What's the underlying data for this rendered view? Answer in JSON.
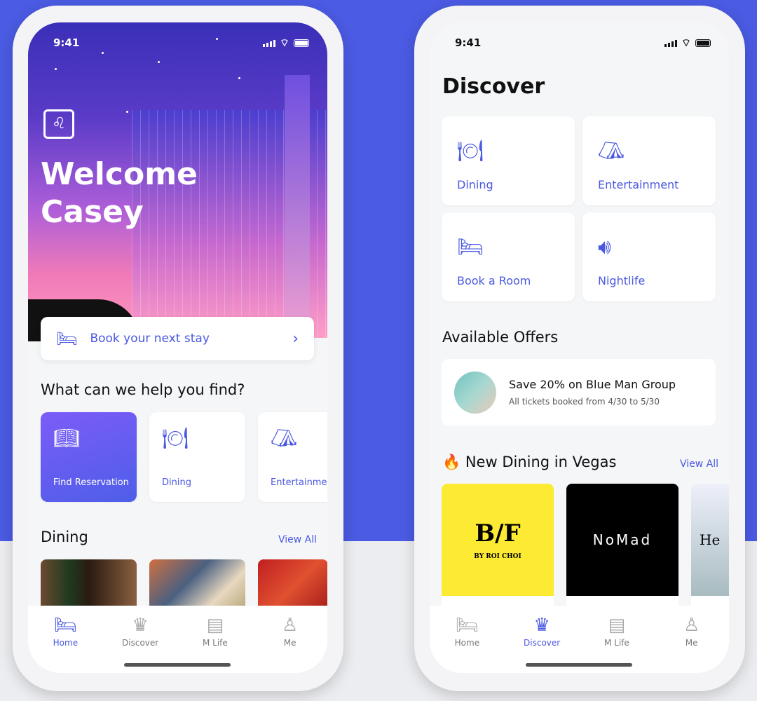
{
  "colors": {
    "accent": "#4a58e0",
    "background": "#4b5be3"
  },
  "home": {
    "status_time": "9:41",
    "welcome": "Welcome Casey",
    "book_stay": "Book your next stay",
    "help_title": "What can we help you find?",
    "quick": [
      {
        "label": "Find Reservation",
        "icon": "book-icon"
      },
      {
        "label": "Dining",
        "icon": "dining-icon"
      },
      {
        "label": "Entertainment",
        "icon": "tent-icon"
      }
    ],
    "dining_title": "Dining",
    "view_all": "View All"
  },
  "discover": {
    "status_time": "9:41",
    "title": "Discover",
    "tiles": [
      {
        "label": "Dining",
        "icon": "dining-icon"
      },
      {
        "label": "Entertainment",
        "icon": "tent-icon"
      },
      {
        "label": "Book a Room",
        "icon": "bed-icon"
      },
      {
        "label": "Nightlife",
        "icon": "speaker-icon"
      }
    ],
    "offers_title": "Available Offers",
    "offer": {
      "title": "Save 20% on Blue Man Group",
      "subtitle": "All tickets booked from 4/30 to 5/30"
    },
    "new_dining_title": "New Dining in Vegas",
    "new_dining_emoji": "🔥",
    "view_all": "View All",
    "restaurants": [
      {
        "logo_main": "B/F",
        "logo_sub": "BY ROI CHOI"
      },
      {
        "logo_main": "NoMad"
      },
      {
        "logo_main": "He"
      }
    ]
  },
  "tabs": [
    {
      "label": "Home",
      "icon": "bed-icon"
    },
    {
      "label": "Discover",
      "icon": "discover-icon"
    },
    {
      "label": "M Life",
      "icon": "card-icon"
    },
    {
      "label": "Me",
      "icon": "person-icon"
    }
  ]
}
